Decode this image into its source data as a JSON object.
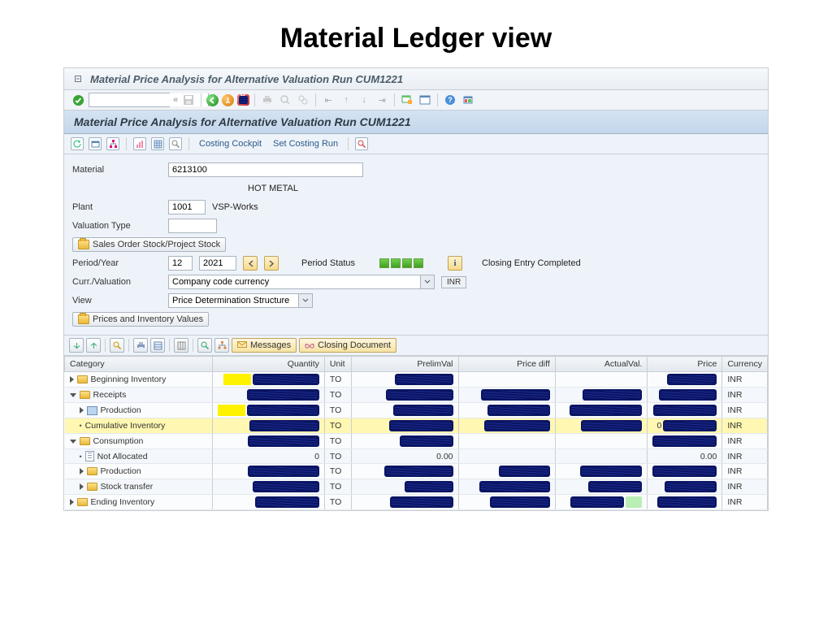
{
  "page": {
    "heading": "Material Ledger view"
  },
  "titlebar": {
    "text": "Material Price Analysis for Alternative Valuation Run CUM1221"
  },
  "subheader": {
    "text": "Material Price Analysis for Alternative Valuation Run CUM1221"
  },
  "toolbar2": {
    "costing_cockpit": "Costing Cockpit",
    "set_costing_run": "Set Costing Run"
  },
  "form": {
    "material_label": "Material",
    "material_value": "6213100",
    "material_desc": "HOT METAL",
    "plant_label": "Plant",
    "plant_value": "1001",
    "plant_desc": "VSP-Works",
    "valtype_label": "Valuation Type",
    "valtype_value": "",
    "sales_stock_btn": "Sales Order Stock/Project Stock",
    "period_label": "Period/Year",
    "period_m": "12",
    "period_y": "2021",
    "period_status_label": "Period Status",
    "closing_status": "Closing Entry Completed",
    "curr_label": "Curr./Valuation",
    "curr_sel": "Company code currency",
    "curr_code": "INR",
    "view_label": "View",
    "view_sel": "Price Determination Structure",
    "prices_btn": "Prices and Inventory Values",
    "messages_btn": "Messages",
    "closingdoc_btn": "Closing Document"
  },
  "table": {
    "headers": {
      "category": "Category",
      "quantity": "Quantity",
      "unit": "Unit",
      "prelim": "PrelimVal",
      "diff": "Price diff",
      "actual": "ActualVal.",
      "price": "Price",
      "curr": "Currency"
    },
    "rows": [
      {
        "icon": "folder",
        "label": "Beginning Inventory",
        "indent": 0,
        "expander": "right",
        "unit": "TO",
        "curr": "INR",
        "qty_redact": true,
        "prelim_redact": true,
        "price_redact": true,
        "qty_yl": true
      },
      {
        "icon": "folder",
        "label": "Receipts",
        "indent": 0,
        "expander": "down",
        "unit": "TO",
        "curr": "INR",
        "qty_redact": true,
        "prelim_redact": true,
        "diff_redact": true,
        "actual_redact": true,
        "price_redact": true
      },
      {
        "icon": "mach",
        "label": "Production",
        "indent": 1,
        "expander": "right",
        "unit": "TO",
        "curr": "INR",
        "qty_redact": true,
        "prelim_redact": true,
        "diff_redact": true,
        "actual_redact": true,
        "price_redact": true,
        "qty_yl": true
      },
      {
        "icon": "",
        "label": "Cumulative Inventory",
        "indent": 1,
        "bullet": true,
        "hl": true,
        "unit": "TO",
        "curr": "INR",
        "qty_redact": true,
        "prelim_redact": true,
        "diff_redact": true,
        "actual_redact": true,
        "price_text": "0",
        "price_redact": true
      },
      {
        "icon": "folder",
        "label": "Consumption",
        "indent": 0,
        "expander": "down",
        "unit": "TO",
        "curr": "INR",
        "qty_redact": true,
        "prelim_redact": true,
        "price_redact": true
      },
      {
        "icon": "doc",
        "label": "Not Allocated",
        "indent": 1,
        "bullet": true,
        "unit": "TO",
        "curr": "INR",
        "qty_text": "0",
        "prelim_text": "0.00",
        "price_text": "0.00"
      },
      {
        "icon": "folder",
        "label": "Production",
        "indent": 1,
        "expander": "right",
        "unit": "TO",
        "curr": "INR",
        "qty_redact": true,
        "prelim_redact": true,
        "diff_redact": true,
        "actual_redact": true,
        "price_redact": true
      },
      {
        "icon": "folder",
        "label": "Stock transfer",
        "indent": 1,
        "expander": "right",
        "unit": "TO",
        "curr": "INR",
        "qty_redact": true,
        "prelim_redact": true,
        "diff_redact": true,
        "actual_redact": true,
        "price_redact": true
      },
      {
        "icon": "folder",
        "label": "Ending Inventory",
        "indent": 0,
        "expander": "right",
        "unit": "TO",
        "curr": "INR",
        "qty_redact": true,
        "prelim_redact": true,
        "diff_redact": true,
        "actual_redact": true,
        "price_redact": true,
        "actual_green": true
      }
    ]
  }
}
